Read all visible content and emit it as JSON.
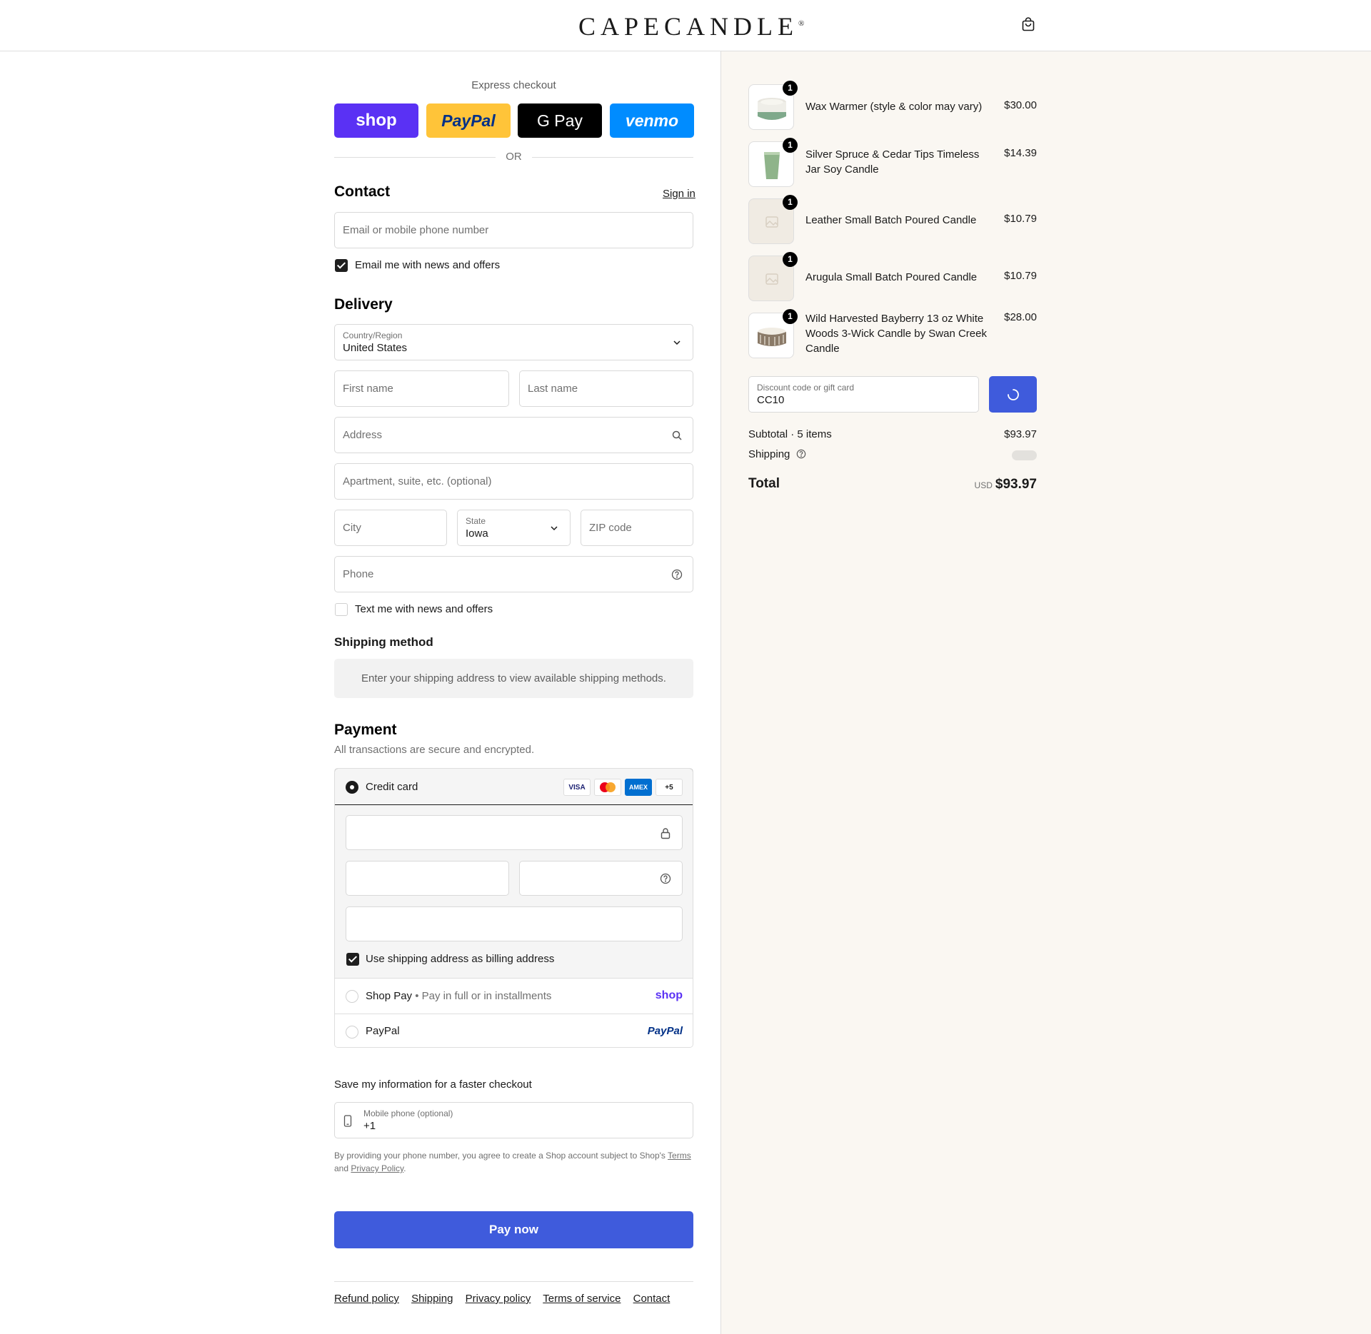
{
  "header": {
    "logo": "CAPECANDLE",
    "logo_mark": "®",
    "cart_icon": "shopping-bag-icon"
  },
  "express": {
    "title": "Express checkout",
    "buttons": [
      "shop",
      "PayPal",
      "G Pay",
      "venmo"
    ],
    "or": "OR"
  },
  "contact": {
    "title": "Contact",
    "sign_in": "Sign in",
    "email_placeholder": "Email or mobile phone number",
    "news_label": "Email me with news and offers",
    "news_checked": true
  },
  "delivery": {
    "title": "Delivery",
    "country_label": "Country/Region",
    "country_value": "United States",
    "first_name": "First name",
    "last_name": "Last name",
    "address": "Address",
    "apartment": "Apartment, suite, etc. (optional)",
    "city": "City",
    "state_label": "State",
    "state_value": "Iowa",
    "zip": "ZIP code",
    "phone": "Phone",
    "text_label": "Text me with news and offers",
    "text_checked": false
  },
  "shipping_method": {
    "title": "Shipping method",
    "message": "Enter your shipping address to view available shipping methods."
  },
  "payment": {
    "title": "Payment",
    "subtitle": "All transactions are secure and encrypted.",
    "credit_card": "Credit card",
    "card_logos": [
      "VISA",
      "MC",
      "AMEX",
      "+5"
    ],
    "billing_label": "Use shipping address as billing address",
    "billing_checked": true,
    "shop_pay": "Shop Pay",
    "shop_pay_sub": "Pay in full or in installments",
    "shop_pay_logo": "shop",
    "paypal": "PayPal",
    "paypal_logo": "PayPal"
  },
  "save": {
    "title": "Save my information for a faster checkout",
    "mobile_label": "Mobile phone (optional)",
    "mobile_value": "+1",
    "fine_1": "By providing your phone number, you agree to create a Shop account subject to Shop's",
    "fine_terms": "Terms",
    "fine_and": "and",
    "fine_privacy": "Privacy Policy",
    "fine_end": "."
  },
  "pay_now": "Pay now",
  "footer": [
    "Refund policy",
    "Shipping",
    "Privacy policy",
    "Terms of service",
    "Contact"
  ],
  "order": {
    "items": [
      {
        "name": "Wax Warmer (style & color may vary)",
        "price": "$30.00",
        "qty": "1"
      },
      {
        "name": "Silver Spruce & Cedar Tips Timeless Jar Soy Candle",
        "price": "$14.39",
        "qty": "1"
      },
      {
        "name": "Leather Small Batch Poured Candle",
        "price": "$10.79",
        "qty": "1"
      },
      {
        "name": "Arugula Small Batch Poured Candle",
        "price": "$10.79",
        "qty": "1"
      },
      {
        "name": "Wild Harvested Bayberry 13 oz White Woods 3-Wick Candle by Swan Creek Candle",
        "price": "$28.00",
        "qty": "1"
      }
    ],
    "discount_label": "Discount code or gift card",
    "discount_value": "CC10",
    "subtotal_label": "Subtotal · 5 items",
    "subtotal_value": "$93.97",
    "shipping_label": "Shipping",
    "total_label": "Total",
    "currency": "USD",
    "total_value": "$93.97"
  },
  "colors": {
    "accent": "#3f5bdc",
    "sidebar_bg": "#faf7f2",
    "shop_purple": "#5a31f4",
    "paypal_yellow": "#ffc439",
    "venmo_blue": "#008cff"
  }
}
